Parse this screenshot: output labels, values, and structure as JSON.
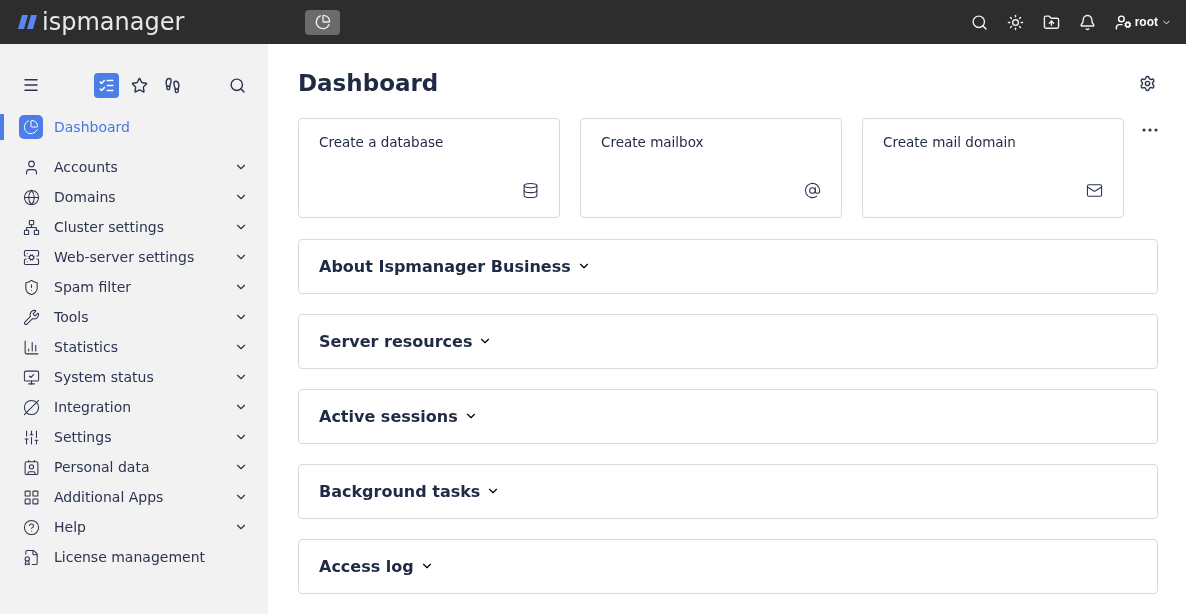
{
  "header": {
    "logo": "ispmanager",
    "user": "root"
  },
  "sidebar": {
    "tabs": [
      {
        "selected": true
      },
      {
        "selected": false
      },
      {
        "selected": false
      }
    ],
    "items": [
      {
        "label": "Dashboard",
        "selected": true,
        "expandable": false
      },
      {
        "label": "Accounts",
        "selected": false,
        "expandable": true
      },
      {
        "label": "Domains",
        "selected": false,
        "expandable": true
      },
      {
        "label": "Cluster settings",
        "selected": false,
        "expandable": true
      },
      {
        "label": "Web-server settings",
        "selected": false,
        "expandable": true
      },
      {
        "label": "Spam filter",
        "selected": false,
        "expandable": true
      },
      {
        "label": "Tools",
        "selected": false,
        "expandable": true
      },
      {
        "label": "Statistics",
        "selected": false,
        "expandable": true
      },
      {
        "label": "System status",
        "selected": false,
        "expandable": true
      },
      {
        "label": "Integration",
        "selected": false,
        "expandable": true
      },
      {
        "label": "Settings",
        "selected": false,
        "expandable": true
      },
      {
        "label": "Personal data",
        "selected": false,
        "expandable": true
      },
      {
        "label": "Additional Apps",
        "selected": false,
        "expandable": true
      },
      {
        "label": "Help",
        "selected": false,
        "expandable": true
      },
      {
        "label": "License management",
        "selected": false,
        "expandable": false
      }
    ]
  },
  "main": {
    "title": "Dashboard",
    "cards": [
      {
        "label": "Create a database"
      },
      {
        "label": "Create mailbox"
      },
      {
        "label": "Create mail domain"
      }
    ],
    "sections": [
      {
        "title": "About Ispmanager Business",
        "expanded": false
      },
      {
        "title": "Server resources",
        "expanded": false
      },
      {
        "title": "Active sessions",
        "expanded": false
      },
      {
        "title": "Background tasks",
        "expanded": false
      },
      {
        "title": "Access log",
        "expanded": false
      }
    ]
  }
}
